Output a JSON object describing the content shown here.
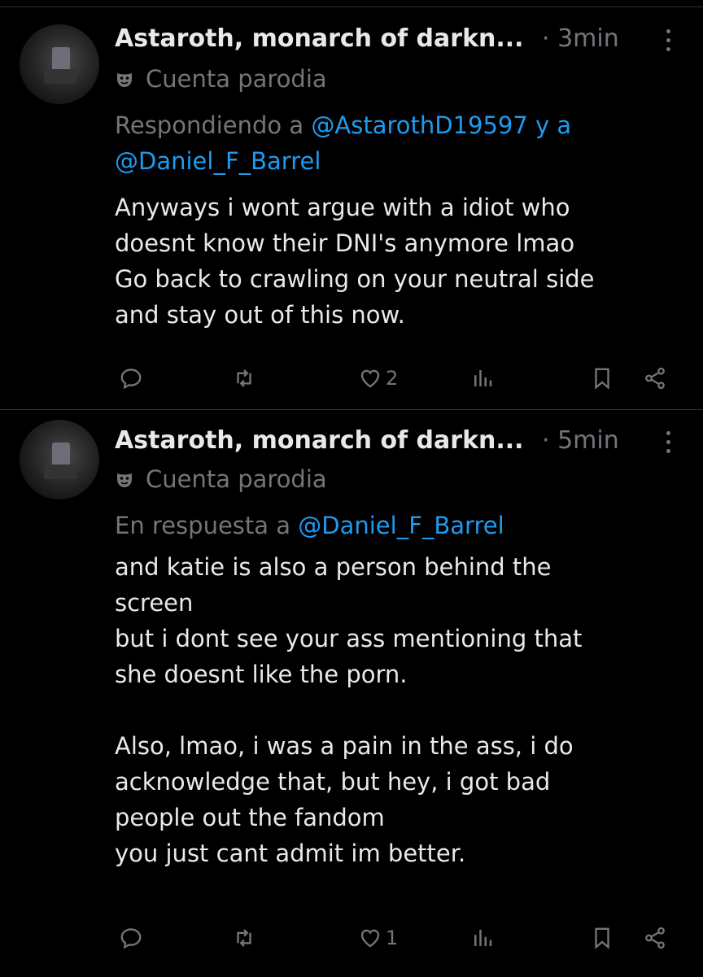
{
  "tweets": [
    {
      "name": "Astaroth, monarch of darkn...",
      "time": "· 3min",
      "badge": "Cuenta parodia",
      "reply_prefix": "Respondiendo a ",
      "mention1": "@AstarothD19597",
      "reply_join": " y a",
      "mention2": "@Daniel_F_Barrel",
      "text": "Anyways i wont argue with a idiot who\ndoesnt know their DNI's anymore lmao\nGo back to crawling on your neutral side\nand stay out of this now.",
      "likes": "2"
    },
    {
      "name": "Astaroth, monarch of darkn...",
      "time": "· 5min",
      "badge": "Cuenta parodia",
      "reply_prefix": "En respuesta a ",
      "mention1": "@Daniel_F_Barrel",
      "text": "and katie is also a person behind the\nscreen\nbut i dont see your ass mentioning that\nshe doesnt like the porn.\n\nAlso, lmao, i was a pain in the ass, i do\nacknowledge that, but hey, i got bad\npeople out the fandom\nyou just cant admit im better.",
      "likes": "1"
    }
  ],
  "icons": {
    "reply": "reply-icon",
    "retweet": "retweet-icon",
    "like": "heart-icon",
    "views": "views-icon",
    "bookmark": "bookmark-icon",
    "share": "share-icon",
    "badge": "parody-mask-icon",
    "more": "more-options-icon"
  },
  "colors": {
    "background": "#000000",
    "text": "#e7e9ea",
    "muted": "#71767b",
    "link": "#1d9bf0",
    "divider": "#2f3336"
  }
}
